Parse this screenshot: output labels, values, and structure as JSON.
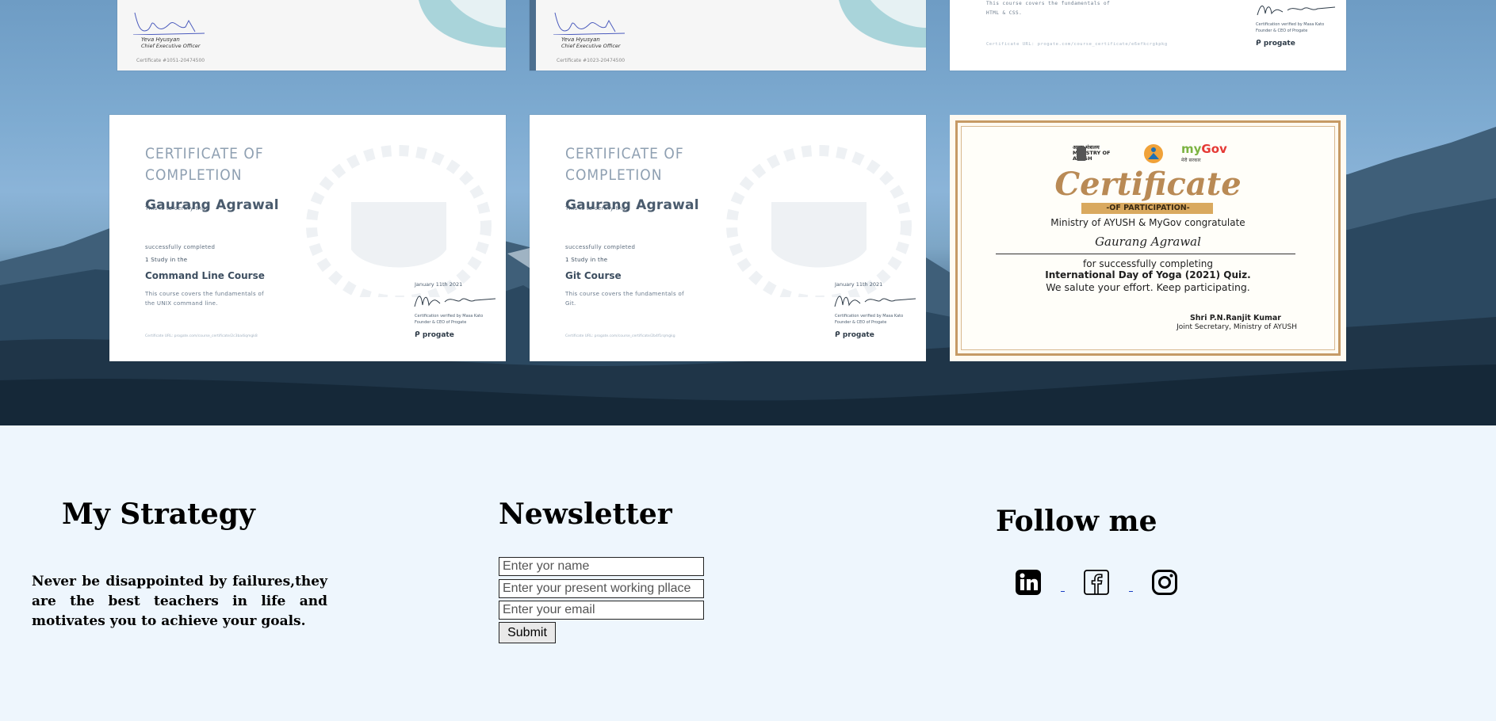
{
  "certificates": {
    "top_row": [
      {
        "signer_name": "Yeva Hyusyan",
        "signer_role": "Chief Executive Officer",
        "cert_no": "Certificate #1051-20474500"
      },
      {
        "signer_name": "Yeva Hyusyan",
        "signer_role": "Chief Executive Officer",
        "cert_no": "Certificate #1023-20474500"
      },
      {
        "desc_line1": "This course covers the fundamentals of",
        "desc_line2": "HTML & CSS.",
        "verify_url": "Certificate URL: progate.com/course_certificate/e6efkcrgkpkg",
        "founder": "Certification verified by Masa Kato",
        "founder_role": "Founder & CEO of Progate",
        "logo": "progate"
      }
    ],
    "progate": [
      {
        "title": "CERTIFICATE OF\nCOMPLETION",
        "certify": "This is to certify that",
        "name": "Gaurang Agrawal",
        "completed": "successfully completed",
        "study": "1 Study in the",
        "course": "Command Line Course",
        "desc": "This course covers the fundamentals of the UNIX command line.",
        "date": "January 11th 2021",
        "verified": "Certification verified by Masa Kato",
        "founder_role": "Founder & CEO of Progate",
        "logo": "progate",
        "url": "Certificate URL: progate.com/course_certificate/2c3ba4iqmgk8"
      },
      {
        "title": "CERTIFICATE OF\nCOMPLETION",
        "certify": "This is to certify that",
        "name": "Gaurang Agrawal",
        "completed": "successfully completed",
        "study": "1 Study in the",
        "course": "Git Course",
        "desc": "This course covers the fundamentals of Git.",
        "date": "January 11th 2021",
        "verified": "Certification verified by Masa Kato",
        "founder_role": "Founder & CEO of Progate",
        "logo": "progate",
        "url": "Certificate URL: progate.com/course_certificate/2b4f1rqmgkg"
      }
    ],
    "ayush": {
      "header_left": "आयुष मंत्रालय\nMINISTRY OF\nAYUSH",
      "header_right_tag": "मेरी सरकार",
      "title": "Certificate",
      "subtitle": "-OF PARTICIPATION-",
      "congrats": "Ministry of AYUSH & MyGov congratulate",
      "name": "Gaurang Agrawal",
      "line1": "for successfully completing",
      "line2": "International Day of Yoga (2021) Quiz.",
      "line3": "We salute your effort. Keep participating.",
      "signer": "Shri P.N.Ranjit Kumar",
      "signer_role": "Joint Secretary, Ministry of AYUSH"
    }
  },
  "footer": {
    "strategy": {
      "heading": "My Strategy",
      "quote": "Never be disappointed by failures,they are the best teachers in life and motivates you to achieve your goals."
    },
    "newsletter": {
      "heading": "Newsletter",
      "name_placeholder": "Enter yor name",
      "workplace_placeholder": "Enter your present working pllace",
      "email_placeholder": "Enter your email",
      "submit_label": "Submit"
    },
    "follow": {
      "heading": "Follow me",
      "icons": [
        "linkedin-icon",
        "facebook-icon",
        "instagram-icon"
      ]
    }
  },
  "colors": {
    "footer_bg": "#eef6fd",
    "link": "#1a3fc4",
    "ayush_gold": "#c69a65"
  }
}
